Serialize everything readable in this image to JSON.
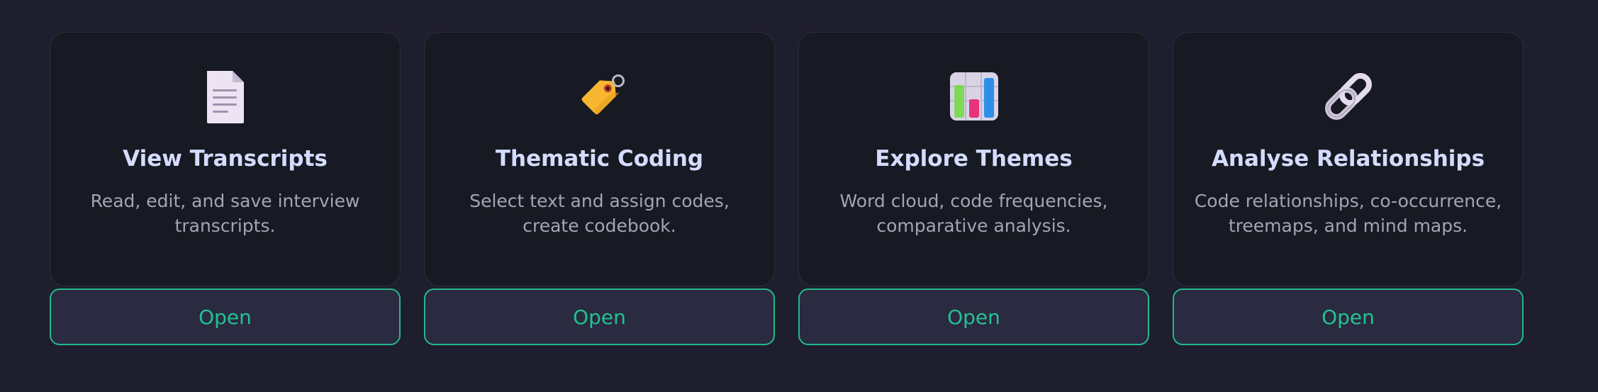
{
  "cards": [
    {
      "icon": "document-icon",
      "title": "View Transcripts",
      "description": "Read, edit, and save interview transcripts.",
      "button_label": "Open"
    },
    {
      "icon": "tag-icon",
      "title": "Thematic Coding",
      "description": "Select text and assign codes, create codebook.",
      "button_label": "Open"
    },
    {
      "icon": "bar-chart-icon",
      "title": "Explore Themes",
      "description": "Word cloud, code frequencies, comparative analysis.",
      "button_label": "Open"
    },
    {
      "icon": "link-icon",
      "title": "Analyse Relationships",
      "description": "Code relationships, co-occurrence, treemaps, and mind maps.",
      "button_label": "Open"
    }
  ],
  "colors": {
    "page_background": "#1f1e2e",
    "card_background": "#171a22",
    "title": "#d4dcff",
    "description": "#a1a6b4",
    "accent": "#22b98b",
    "button_background": "#2a2a40"
  }
}
